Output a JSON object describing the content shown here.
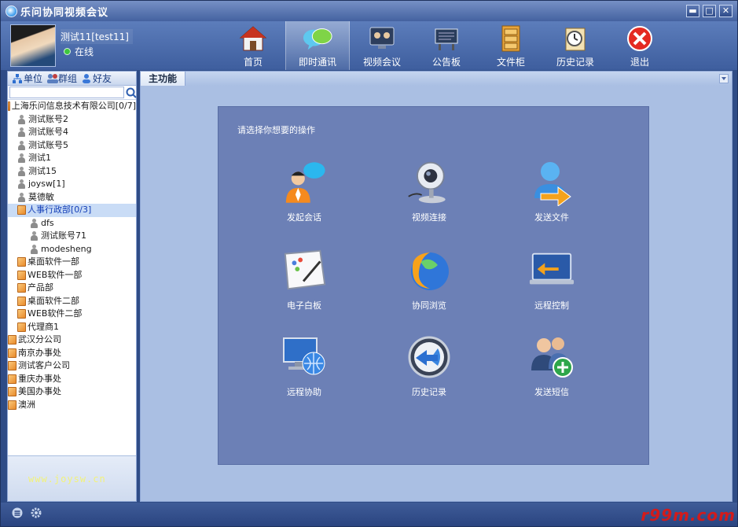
{
  "window": {
    "title": "乐问协同视频会议",
    "controls": [
      "minimize",
      "maximize",
      "close"
    ]
  },
  "user": {
    "name": "测试11[test11]",
    "status": "在线"
  },
  "toolbar": [
    {
      "id": "home",
      "label": "首页",
      "icon": "house-icon"
    },
    {
      "id": "im",
      "label": "即时通讯",
      "icon": "chat-bubbles-icon",
      "active": true
    },
    {
      "id": "video",
      "label": "视频会议",
      "icon": "video-conference-icon"
    },
    {
      "id": "board",
      "label": "公告板",
      "icon": "notice-board-icon"
    },
    {
      "id": "cabinet",
      "label": "文件柜",
      "icon": "file-cabinet-icon"
    },
    {
      "id": "history",
      "label": "历史记录",
      "icon": "history-icon"
    },
    {
      "id": "exit",
      "label": "退出",
      "icon": "exit-icon"
    }
  ],
  "sidebar": {
    "tabs": [
      "单位",
      "群组",
      "好友"
    ],
    "search": {
      "value": "",
      "placeholder": ""
    },
    "tree": [
      {
        "label": "上海乐问信息技术有限公司[0/7]",
        "type": "folder",
        "level": 0
      },
      {
        "label": "测试账号2",
        "type": "person",
        "level": 1
      },
      {
        "label": "测试账号4",
        "type": "person",
        "level": 1
      },
      {
        "label": "测试账号5",
        "type": "person",
        "level": 1
      },
      {
        "label": "测试1",
        "type": "person",
        "level": 1
      },
      {
        "label": "测试15",
        "type": "person",
        "level": 1
      },
      {
        "label": "joysw[1]",
        "type": "person",
        "level": 1
      },
      {
        "label": "莫德敏",
        "type": "person",
        "level": 1
      },
      {
        "label": "人事行政部[0/3]",
        "type": "folder",
        "level": 1,
        "selected": true
      },
      {
        "label": "dfs",
        "type": "person",
        "level": 2
      },
      {
        "label": "测试账号71",
        "type": "person",
        "level": 2
      },
      {
        "label": "modesheng",
        "type": "person",
        "level": 2
      },
      {
        "label": "桌面软件一部",
        "type": "folder",
        "level": 1
      },
      {
        "label": "WEB软件一部",
        "type": "folder",
        "level": 1
      },
      {
        "label": "产品部",
        "type": "folder",
        "level": 1
      },
      {
        "label": "桌面软件二部",
        "type": "folder",
        "level": 1
      },
      {
        "label": "WEB软件二部",
        "type": "folder",
        "level": 1
      },
      {
        "label": "代理商1",
        "type": "folder",
        "level": 1
      },
      {
        "label": "武汉分公司",
        "type": "folder",
        "level": 0
      },
      {
        "label": "南京办事处",
        "type": "folder",
        "level": 0
      },
      {
        "label": "测试客户公司",
        "type": "folder",
        "level": 0
      },
      {
        "label": "重庆办事处",
        "type": "folder",
        "level": 0
      },
      {
        "label": "美国办事处",
        "type": "folder",
        "level": 0
      },
      {
        "label": "澳洲",
        "type": "folder",
        "level": 0
      }
    ],
    "footer_site": "www.joysw.cn"
  },
  "main": {
    "tab_label": "主功能",
    "prompt": "请选择你想要的操作",
    "functions": [
      {
        "label": "发起会话",
        "icon": "start-chat-icon"
      },
      {
        "label": "视频连接",
        "icon": "webcam-icon"
      },
      {
        "label": "发送文件",
        "icon": "send-file-icon"
      },
      {
        "label": "电子白板",
        "icon": "whiteboard-icon"
      },
      {
        "label": "协同浏览",
        "icon": "co-browse-icon"
      },
      {
        "label": "远程控制",
        "icon": "remote-control-icon"
      },
      {
        "label": "远程协助",
        "icon": "remote-assist-icon"
      },
      {
        "label": "历史记录",
        "icon": "history-clock-icon"
      },
      {
        "label": "发送短信",
        "icon": "send-sms-icon"
      }
    ]
  },
  "statusbar": {
    "watermark": "r99m.com"
  }
}
